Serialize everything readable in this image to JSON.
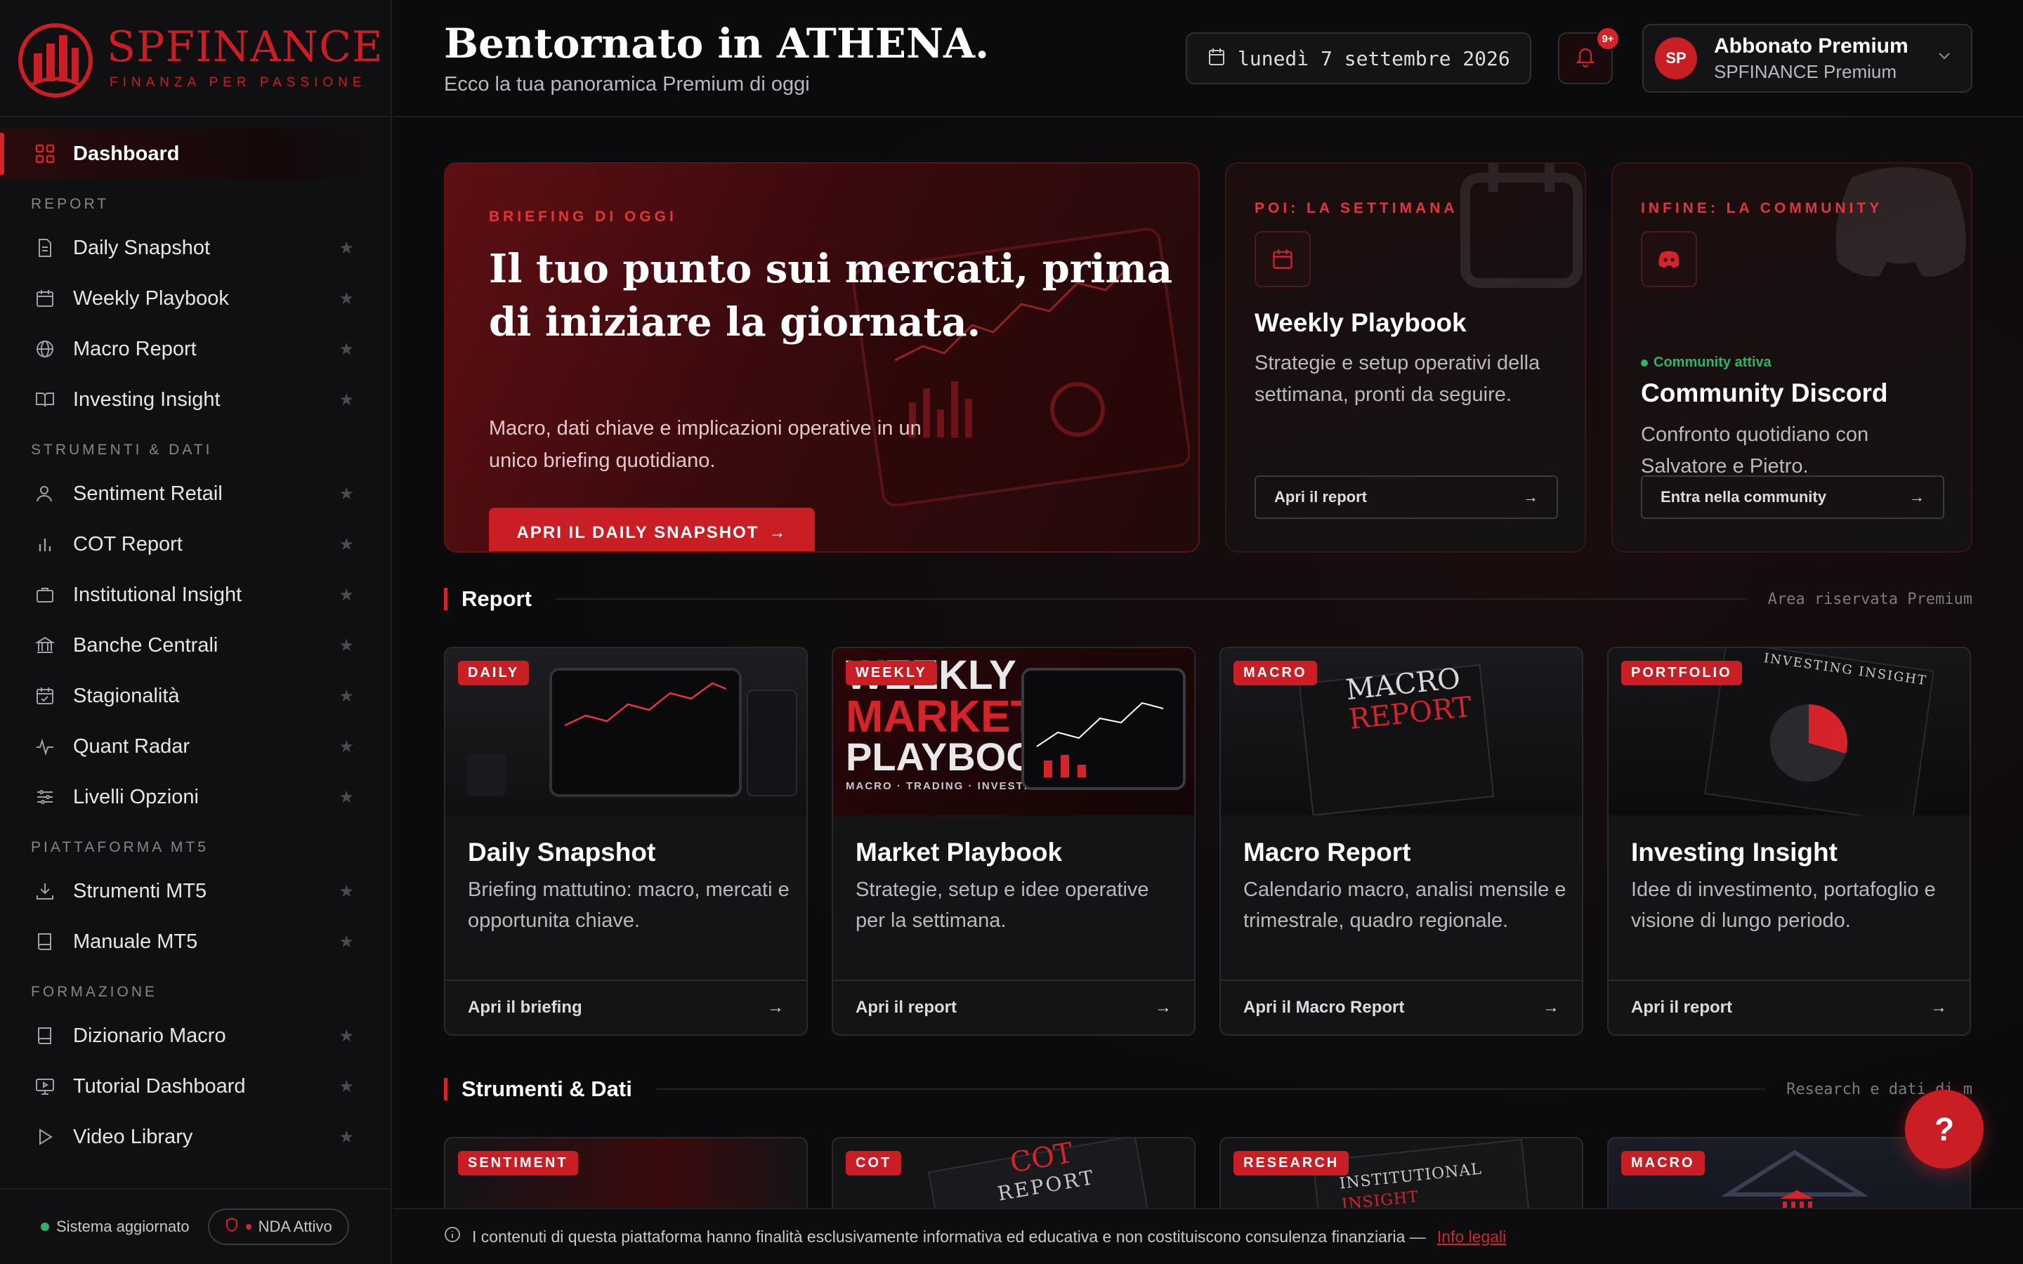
{
  "brand": {
    "name": "SPFINANCE",
    "tagline": "FINANZA PER PASSIONE",
    "accent": "#c81e24"
  },
  "sidebar": {
    "dashboard": "Dashboard",
    "sections": [
      {
        "title": "REPORT",
        "items": [
          "Daily Snapshot",
          "Weekly Playbook",
          "Macro Report",
          "Investing Insight"
        ]
      },
      {
        "title": "STRUMENTI & DATI",
        "items": [
          "Sentiment Retail",
          "COT Report",
          "Institutional Insight",
          "Banche Centrali",
          "Stagionalità",
          "Quant Radar",
          "Livelli Opzioni"
        ]
      },
      {
        "title": "PIATTAFORMA MT5",
        "items": [
          "Strumenti MT5",
          "Manuale MT5"
        ]
      },
      {
        "title": "FORMAZIONE",
        "items": [
          "Dizionario Macro",
          "Tutorial Dashboard",
          "Video Library"
        ]
      }
    ],
    "star": "★",
    "footer": {
      "status": "Sistema aggiornato",
      "nda": "NDA Attivo"
    }
  },
  "header": {
    "welcome": "Bentornato in ATHENA.",
    "subtitle": "Ecco la tua panoramica Premium di oggi",
    "date": "lunedì 7 settembre 2026",
    "notifications": "9+",
    "user": {
      "initials": "SP",
      "name": "Abbonato Premium",
      "plan": "SPFINANCE Premium"
    }
  },
  "hero": {
    "eyebrow": "BRIEFING DI OGGI",
    "title": "Il tuo punto sui mercati, prima di iniziare la giornata.",
    "subtitle": "Macro, dati chiave e implicazioni operative in un unico briefing quotidiano.",
    "button": "APRI IL DAILY SNAPSHOT",
    "arrow": "→"
  },
  "week_card": {
    "eyebrow": "POI: LA SETTIMANA",
    "title": "Weekly Playbook",
    "text": "Strategie e setup operativi della settimana, pronti da seguire.",
    "button": "Apri il report"
  },
  "community_card": {
    "eyebrow": "INFINE: LA COMMUNITY",
    "status": "Community attiva",
    "title": "Community Discord",
    "text": "Confronto quotidiano con Salvatore e Pietro.",
    "button": "Entra nella community"
  },
  "report_section": {
    "title": "Report",
    "note": "Area riservata Premium",
    "cards": [
      {
        "tag": "DAILY",
        "title": "Daily Snapshot",
        "text": "Briefing mattutino: macro, mercati e opportunita chiave.",
        "link": "Apri il briefing"
      },
      {
        "tag": "WEEKLY",
        "title": "Market Playbook",
        "text": "Strategie, setup e idee operative per la settimana.",
        "link": "Apri il report"
      },
      {
        "tag": "MACRO",
        "title": "Macro Report",
        "text": "Calendario macro, analisi mensile e trimestrale, quadro regionale.",
        "link": "Apri il Macro Report"
      },
      {
        "tag": "PORTFOLIO",
        "title": "Investing Insight",
        "text": "Idee di investimento, portafoglio e visione di lungo periodo.",
        "link": "Apri il report"
      }
    ],
    "thumb_text": {
      "weekly_1": "WEEKLY",
      "weekly_2": "MARKET",
      "weekly_3": "PLAYBOOK",
      "weekly_4": "MACRO · TRADING · INVESTING",
      "macro_1": "MACRO",
      "macro_2": "REPORT",
      "investing": "INVESTING INSIGHT"
    }
  },
  "tools_section": {
    "title": "Strumenti & Dati",
    "note": "Research e dati di m",
    "cards": [
      {
        "tag": "SENTIMENT"
      },
      {
        "tag": "COT",
        "thumb_1": "COT",
        "thumb_2": "REPORT"
      },
      {
        "tag": "RESEARCH",
        "thumb_1": "INSTITUTIONAL",
        "thumb_2": "INSIGHT"
      },
      {
        "tag": "MACRO"
      }
    ]
  },
  "footer": {
    "disclaimer": "I contenuti di questa piattaforma hanno finalità esclusivamente informativa ed educativa e non costituiscono consulenza finanziaria —",
    "link": "Info legali"
  },
  "help": "?"
}
